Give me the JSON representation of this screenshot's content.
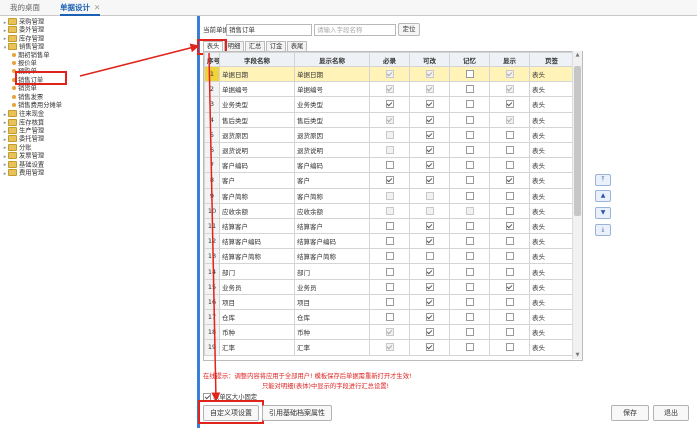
{
  "tabs": [
    {
      "label": "我的桌面",
      "active": false
    },
    {
      "label": "单据设计",
      "active": true
    }
  ],
  "tab_close": "✕",
  "tree": [
    {
      "label": "采购管理",
      "level": 0,
      "type": "folder",
      "open": false
    },
    {
      "label": "委外管理",
      "level": 0,
      "type": "folder",
      "open": false
    },
    {
      "label": "库存管理",
      "level": 0,
      "type": "folder",
      "open": false
    },
    {
      "label": "销售管理",
      "level": 0,
      "type": "folder",
      "open": true
    },
    {
      "label": "期初销售单",
      "level": 1,
      "type": "leaf"
    },
    {
      "label": "报价单",
      "level": 1,
      "type": "leaf"
    },
    {
      "label": "预购单",
      "level": 1,
      "type": "leaf"
    },
    {
      "label": "销售订单",
      "level": 1,
      "type": "leaf",
      "highlight": true
    },
    {
      "label": "销货单",
      "level": 1,
      "type": "leaf"
    },
    {
      "label": "销售发票",
      "level": 1,
      "type": "leaf"
    },
    {
      "label": "销售费用分摊单",
      "level": 1,
      "type": "leaf"
    },
    {
      "label": "往来现金",
      "level": 0,
      "type": "folder",
      "open": false
    },
    {
      "label": "库存核算",
      "level": 0,
      "type": "folder",
      "open": false
    },
    {
      "label": "生产管理",
      "level": 0,
      "type": "folder",
      "open": false
    },
    {
      "label": "委托管理",
      "level": 0,
      "type": "folder",
      "open": false
    },
    {
      "label": "分账",
      "level": 0,
      "type": "folder",
      "open": false
    },
    {
      "label": "发票管理",
      "level": 0,
      "type": "folder",
      "open": false
    },
    {
      "label": "基础设置",
      "level": 0,
      "type": "folder",
      "open": false
    },
    {
      "label": "费用管理",
      "level": 0,
      "type": "folder",
      "open": false
    }
  ],
  "form": {
    "current_label": "当前单据",
    "current_value": "销售订单",
    "search_placeholder": "请输入字段名称",
    "locate_button": "定位"
  },
  "subtabs": [
    "表头",
    "明细",
    "汇总",
    "订金",
    "表尾"
  ],
  "table": {
    "headers": [
      "序号",
      "字段名称",
      "显示名称",
      "必录",
      "可改",
      "记忆",
      "显示",
      "页签"
    ],
    "rows": [
      {
        "no": "1",
        "field": "单据日期",
        "display": "单据日期",
        "must": [
          true,
          true
        ],
        "edit": [
          true,
          true
        ],
        "mem": [
          false,
          false
        ],
        "show": [
          true,
          true
        ],
        "tab": "表头"
      },
      {
        "no": "2",
        "field": "单据编号",
        "display": "单据编号",
        "must": [
          true,
          true
        ],
        "edit": [
          true,
          true
        ],
        "mem": [
          false,
          false
        ],
        "show": [
          true,
          true
        ],
        "tab": "表头"
      },
      {
        "no": "3",
        "field": "业务类型",
        "display": "业务类型",
        "must": [
          true,
          false
        ],
        "edit": [
          true,
          false
        ],
        "mem": [
          false,
          false
        ],
        "show": [
          true,
          false
        ],
        "tab": "表头"
      },
      {
        "no": "4",
        "field": "售后类型",
        "display": "售后类型",
        "must": [
          true,
          true
        ],
        "edit": [
          true,
          false
        ],
        "mem": [
          false,
          false
        ],
        "show": [
          true,
          true
        ],
        "tab": "表头"
      },
      {
        "no": "5",
        "field": "退货原因",
        "display": "退货原因",
        "must": [
          false,
          true
        ],
        "edit": [
          true,
          false
        ],
        "mem": [
          false,
          false
        ],
        "show": [
          false,
          false
        ],
        "tab": "表头"
      },
      {
        "no": "6",
        "field": "退货说明",
        "display": "退货说明",
        "must": [
          false,
          true
        ],
        "edit": [
          true,
          false
        ],
        "mem": [
          false,
          false
        ],
        "show": [
          false,
          false
        ],
        "tab": "表头"
      },
      {
        "no": "7",
        "field": "客户编码",
        "display": "客户编码",
        "must": [
          false,
          false
        ],
        "edit": [
          true,
          false
        ],
        "mem": [
          false,
          false
        ],
        "show": [
          false,
          false
        ],
        "tab": "表头"
      },
      {
        "no": "8",
        "field": "客户",
        "display": "客户",
        "must": [
          true,
          false
        ],
        "edit": [
          true,
          false
        ],
        "mem": [
          false,
          false
        ],
        "show": [
          true,
          false
        ],
        "tab": "表头"
      },
      {
        "no": "9",
        "field": "客户简称",
        "display": "客户简称",
        "must": [
          false,
          true
        ],
        "edit": [
          false,
          true
        ],
        "mem": [
          false,
          false
        ],
        "show": [
          false,
          false
        ],
        "tab": "表头"
      },
      {
        "no": "10",
        "field": "应收余额",
        "display": "应收余额",
        "must": [
          false,
          true
        ],
        "edit": [
          false,
          true
        ],
        "mem": [
          false,
          true
        ],
        "show": [
          false,
          false
        ],
        "tab": "表头"
      },
      {
        "no": "11",
        "field": "结算客户",
        "display": "结算客户",
        "must": [
          false,
          false
        ],
        "edit": [
          true,
          false
        ],
        "mem": [
          false,
          false
        ],
        "show": [
          true,
          false
        ],
        "tab": "表头"
      },
      {
        "no": "12",
        "field": "结算客户编码",
        "display": "结算客户编码",
        "must": [
          false,
          false
        ],
        "edit": [
          true,
          false
        ],
        "mem": [
          false,
          false
        ],
        "show": [
          false,
          false
        ],
        "tab": "表头"
      },
      {
        "no": "13",
        "field": "结算客户简称",
        "display": "结算客户简称",
        "must": [
          false,
          false
        ],
        "edit": [
          false,
          false
        ],
        "mem": [
          false,
          false
        ],
        "show": [
          false,
          false
        ],
        "tab": "表头"
      },
      {
        "no": "14",
        "field": "部门",
        "display": "部门",
        "must": [
          false,
          false
        ],
        "edit": [
          true,
          false
        ],
        "mem": [
          false,
          false
        ],
        "show": [
          false,
          false
        ],
        "tab": "表头"
      },
      {
        "no": "15",
        "field": "业务员",
        "display": "业务员",
        "must": [
          false,
          false
        ],
        "edit": [
          true,
          false
        ],
        "mem": [
          false,
          false
        ],
        "show": [
          true,
          false
        ],
        "tab": "表头"
      },
      {
        "no": "16",
        "field": "项目",
        "display": "项目",
        "must": [
          false,
          false
        ],
        "edit": [
          true,
          false
        ],
        "mem": [
          false,
          false
        ],
        "show": [
          false,
          false
        ],
        "tab": "表头"
      },
      {
        "no": "17",
        "field": "仓库",
        "display": "仓库",
        "must": [
          false,
          false
        ],
        "edit": [
          true,
          false
        ],
        "mem": [
          false,
          false
        ],
        "show": [
          false,
          false
        ],
        "tab": "表头"
      },
      {
        "no": "18",
        "field": "币种",
        "display": "币种",
        "must": [
          true,
          true
        ],
        "edit": [
          true,
          false
        ],
        "mem": [
          false,
          false
        ],
        "show": [
          false,
          false
        ],
        "tab": "表头"
      },
      {
        "no": "19",
        "field": "汇率",
        "display": "汇率",
        "must": [
          true,
          true
        ],
        "edit": [
          true,
          false
        ],
        "mem": [
          false,
          false
        ],
        "show": [
          false,
          false
        ],
        "tab": "表头"
      }
    ]
  },
  "move_buttons": [
    "top",
    "up",
    "down",
    "bottom"
  ],
  "note_line1": "在线提示：调整内容将应用于全部用户!  模板保存后单据需重新打开才生效!",
  "note_line2": "只能对明细(表体)中显示的字段进行汇总设置!",
  "checkbox_label": "表单区大小固定",
  "buttons": {
    "custom": "自定义项设置",
    "ref": "引用基础档案属性",
    "save": "保存",
    "exit": "退出"
  },
  "colors": {
    "accent": "#1a60b5",
    "highlight": "#e0231b",
    "note": "#d22"
  }
}
